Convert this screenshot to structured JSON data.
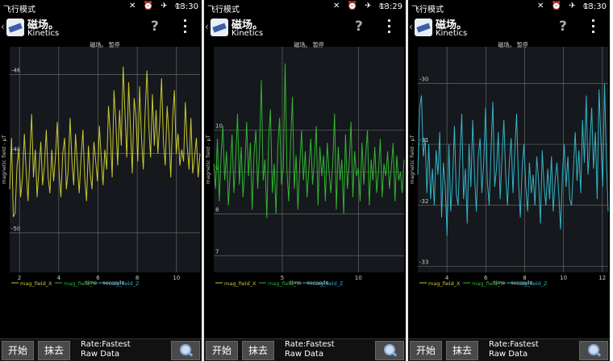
{
  "status": {
    "carrier": "飞行模式",
    "icons": "✕ ⏰ ✈ ▭"
  },
  "app": {
    "title": "磁场。",
    "subtitle": "Kinetics",
    "help": "?"
  },
  "chart_header": "磁场。 暂停",
  "bottom": {
    "start": "开始",
    "erase": "抹去",
    "rate": "Rate:Fastest",
    "raw": "Raw Data"
  },
  "legend": [
    "mag_field_X",
    "mag_field_Y",
    "mag_field_Z"
  ],
  "xlabel": "time - seconds",
  "ylabel": "magnetic field - μT",
  "colors": {
    "accent": "#33b5e5",
    "x": "#c8c832",
    "y": "#32b432",
    "z": "#32b4c8",
    "grid": "#666666",
    "plot_bg": "#15181c"
  },
  "panels": [
    {
      "time": "13:30",
      "series": 0
    },
    {
      "time": "13:29",
      "series": 1
    },
    {
      "time": "13:30",
      "series": 2
    }
  ],
  "chart_data": [
    {
      "type": "line",
      "series": [
        {
          "name": "mag_field_X",
          "values": [
            -48.9,
            -47.6,
            -49.6,
            -49.5,
            -48.3,
            -47.9,
            -49.1,
            -48.6,
            -47.5,
            -48.4,
            -49.2,
            -48.1,
            -47.0,
            -48.6,
            -47.9,
            -49.1,
            -48.4,
            -47.7,
            -48.8,
            -48.3,
            -47.4,
            -48.6,
            -49.0,
            -47.9,
            -48.7,
            -48.1,
            -47.2,
            -48.5,
            -49.1,
            -48.0,
            -47.6,
            -48.9,
            -48.4,
            -47.1,
            -48.2,
            -48.8,
            -47.5,
            -48.3,
            -49.0,
            -48.1,
            -47.4,
            -48.6,
            -49.2,
            -47.8,
            -48.5,
            -48.9,
            -47.7,
            -48.2,
            -48.7,
            -47.3,
            -48.1,
            -48.8,
            -47.9,
            -48.4,
            -46.8,
            -47.5,
            -48.6,
            -46.4,
            -47.2,
            -48.3,
            -46.9,
            -47.8,
            -45.8,
            -47.0,
            -48.1,
            -46.2,
            -47.4,
            -48.5,
            -46.6,
            -47.1,
            -48.2,
            -46.3,
            -47.6,
            -48.4,
            -47.0,
            -45.9,
            -47.3,
            -48.1,
            -46.5,
            -47.8,
            -46.9,
            -48.0,
            -47.2,
            -46.1,
            -47.7,
            -48.3,
            -46.8,
            -47.5,
            -48.6,
            -47.1,
            -46.4,
            -48.0,
            -47.5,
            -48.3,
            -47.9,
            -48.2,
            -46.7,
            -47.8,
            -48.4,
            -47.1,
            -48.5,
            -48.1,
            -47.6,
            -48.6,
            -48.0
          ]
        }
      ],
      "xlabel": "time - seconds",
      "ylabel": "magnetic field - μT",
      "xticks": [
        2,
        4,
        6,
        8,
        10
      ],
      "yticks": [
        -46,
        -48,
        -50
      ],
      "xlim": [
        1.5,
        11.2
      ],
      "ylim": [
        -51.0,
        -45.3
      ]
    },
    {
      "type": "line",
      "series": [
        {
          "name": "mag_field_Y",
          "values": [
            9.2,
            8.6,
            9.8,
            8.3,
            9.4,
            10.1,
            8.8,
            9.5,
            8.2,
            9.0,
            9.9,
            8.5,
            9.3,
            10.4,
            8.7,
            9.6,
            8.4,
            9.1,
            10.2,
            8.9,
            9.7,
            8.1,
            9.4,
            10.0,
            8.6,
            9.5,
            11.2,
            8.8,
            9.3,
            7.9,
            9.8,
            10.5,
            8.5,
            9.2,
            8.0,
            9.6,
            10.3,
            8.7,
            9.1,
            11.6,
            9.0,
            8.3,
            9.7,
            10.8,
            8.6,
            9.4,
            8.1,
            9.2,
            10.0,
            8.8,
            9.5,
            8.4,
            9.1,
            9.8,
            8.7,
            9.3,
            10.1,
            8.2,
            9.6,
            8.9,
            9.4,
            8.3,
            9.7,
            9.0,
            8.5,
            9.2,
            10.4,
            8.1,
            9.6,
            8.8,
            9.3,
            8.0,
            9.9,
            8.6,
            9.2,
            10.2,
            8.4,
            9.5,
            8.9,
            9.1,
            8.3,
            9.7,
            8.7,
            9.4,
            10.0,
            8.2,
            9.3,
            8.8,
            9.6,
            8.5,
            9.0,
            9.8,
            8.4,
            9.2,
            8.9,
            9.5,
            8.6,
            9.1,
            9.7,
            8.3,
            9.4,
            8.8,
            9.0,
            8.5,
            9.3
          ]
        }
      ],
      "xlabel": "time - seconds",
      "ylabel": "magnetic field - μT",
      "xticks": [
        5,
        10
      ],
      "yticks": [
        10,
        9,
        8,
        7
      ],
      "xlim": [
        0.5,
        13.0
      ],
      "ylim": [
        6.6,
        12.0
      ]
    },
    {
      "type": "line",
      "series": [
        {
          "name": "mag_field_Z",
          "values": [
            -31.5,
            -30.4,
            -30.2,
            -31.2,
            -30.9,
            -31.8,
            -31.0,
            -31.9,
            -31.4,
            -32.0,
            -31.1,
            -31.5,
            -30.8,
            -32.2,
            -31.3,
            -31.7,
            -32.5,
            -31.0,
            -32.1,
            -31.6,
            -30.7,
            -31.8,
            -32.0,
            -31.2,
            -30.5,
            -31.9,
            -31.4,
            -32.3,
            -31.0,
            -31.7,
            -30.6,
            -31.5,
            -32.1,
            -31.2,
            -30.9,
            -31.8,
            -31.3,
            -30.4,
            -31.6,
            -32.0,
            -31.1,
            -30.3,
            -31.7,
            -31.4,
            -30.8,
            -31.9,
            -31.2,
            -30.6,
            -31.5,
            -32.0,
            -31.3,
            -30.9,
            -31.8,
            -31.1,
            -30.5,
            -31.6,
            -32.2,
            -31.4,
            -31.0,
            -31.7,
            -32.1,
            -31.3,
            -31.8,
            -31.5,
            -32.0,
            -31.2,
            -31.6,
            -32.3,
            -31.1,
            -31.7,
            -32.0,
            -31.4,
            -31.9,
            -31.2,
            -32.1,
            -31.6,
            -31.3,
            -31.8,
            -32.4,
            -31.5,
            -31.0,
            -31.7,
            -31.2,
            -31.9,
            -32.0,
            -31.4,
            -30.8,
            -31.6,
            -31.1,
            -31.8,
            -30.6,
            -31.3,
            -30.2,
            -31.5,
            -31.0,
            -30.4,
            -31.4,
            -30.8,
            -31.9,
            -30.1,
            -30.9,
            -31.7,
            -30.0,
            -31.2,
            -32.1
          ]
        }
      ],
      "xlabel": "time - seconds",
      "ylabel": "magnetic field - μT",
      "xticks": [
        4,
        6,
        8,
        10,
        12
      ],
      "yticks": [
        -30,
        -31,
        -32,
        -33
      ],
      "xlim": [
        2.5,
        12.3
      ],
      "ylim": [
        -33.1,
        -29.4
      ]
    }
  ]
}
